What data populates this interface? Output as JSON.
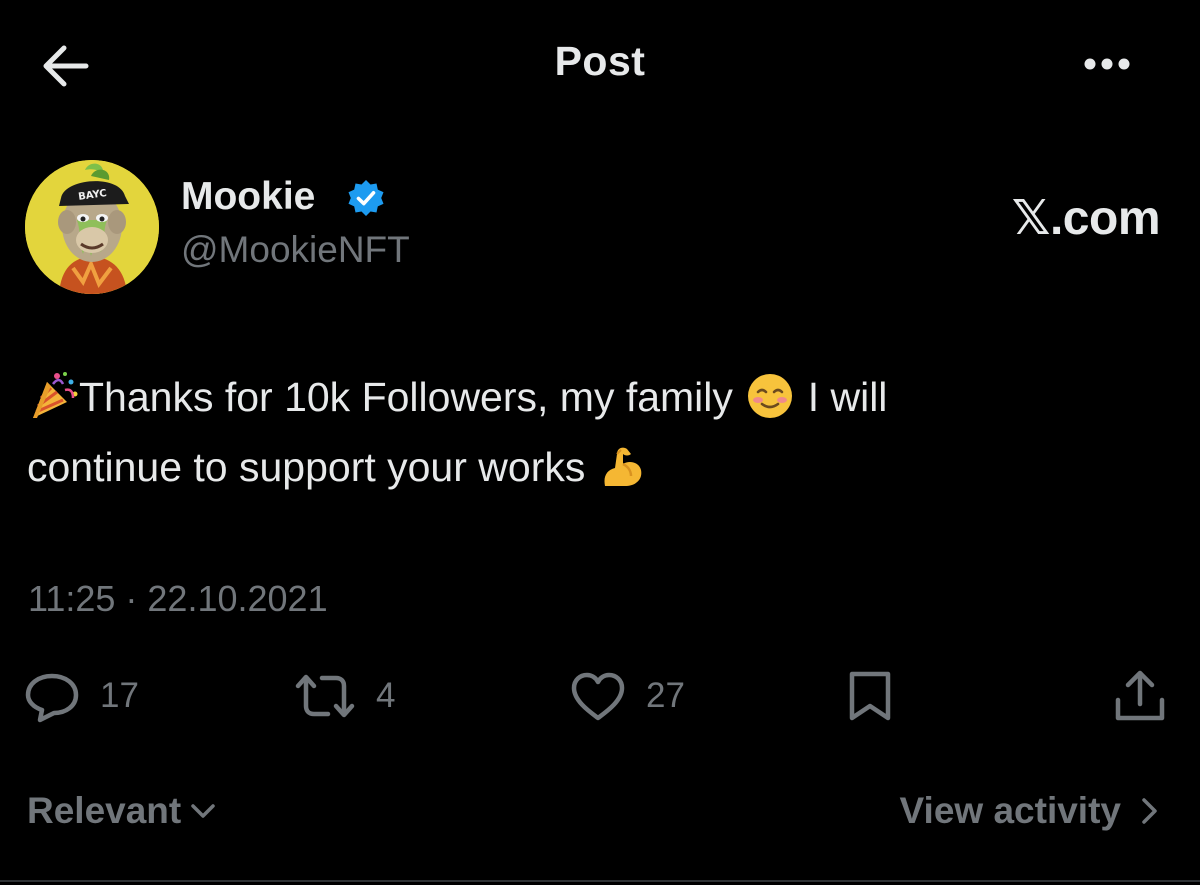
{
  "header": {
    "title": "Post",
    "back_icon": "arrow-left-icon",
    "more_icon": "more-horizontal-icon"
  },
  "author": {
    "display_name": "Mookie",
    "handle": "@MookieNFT",
    "verified": true,
    "verified_color": "#1d9bf0",
    "avatar_label": "BAYC"
  },
  "watermark": "𝕏.com",
  "post": {
    "line1_text_a": "Thanks for 10k Followers, my family ",
    "line1_text_b": " I will",
    "line2_text": "continue to support your works ",
    "emojis": [
      "party-popper",
      "smiling-face",
      "flexed-biceps"
    ],
    "timestamp": "11:25 · 22.10.2021"
  },
  "actions": {
    "reply_count": "17",
    "retweet_count": "4",
    "like_count": "27"
  },
  "footer": {
    "relevant_label": "Relevant",
    "view_activity_label": "View activity"
  },
  "colors": {
    "background": "#000000",
    "primary_text": "#e7e9ea",
    "secondary_text": "#71767b",
    "accent": "#1d9bf0"
  }
}
